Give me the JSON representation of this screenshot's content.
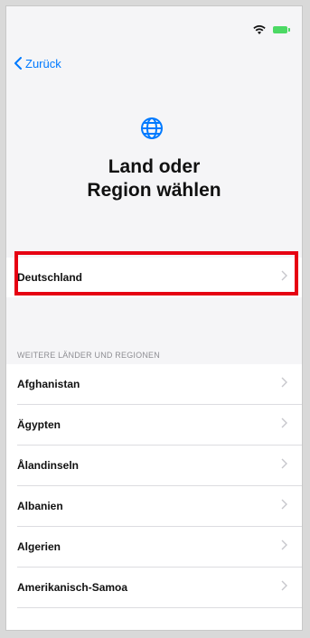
{
  "status_bar": {
    "wifi_icon": "wifi-icon",
    "battery_icon": "battery-icon",
    "battery_color": "#4cd964"
  },
  "nav": {
    "back_label": "Zurück",
    "accent": "#007aff"
  },
  "header": {
    "icon": "globe-icon",
    "title_line1": "Land oder",
    "title_line2": "Region wählen"
  },
  "selected": {
    "label": "Deutschland",
    "highlight_color": "#e60012"
  },
  "section": {
    "header": "WEITERE LÄNDER UND REGIONEN"
  },
  "countries": [
    {
      "label": "Afghanistan"
    },
    {
      "label": "Ägypten"
    },
    {
      "label": "Ålandinseln"
    },
    {
      "label": "Albanien"
    },
    {
      "label": "Algerien"
    },
    {
      "label": "Amerikanisch-Samoa"
    }
  ]
}
